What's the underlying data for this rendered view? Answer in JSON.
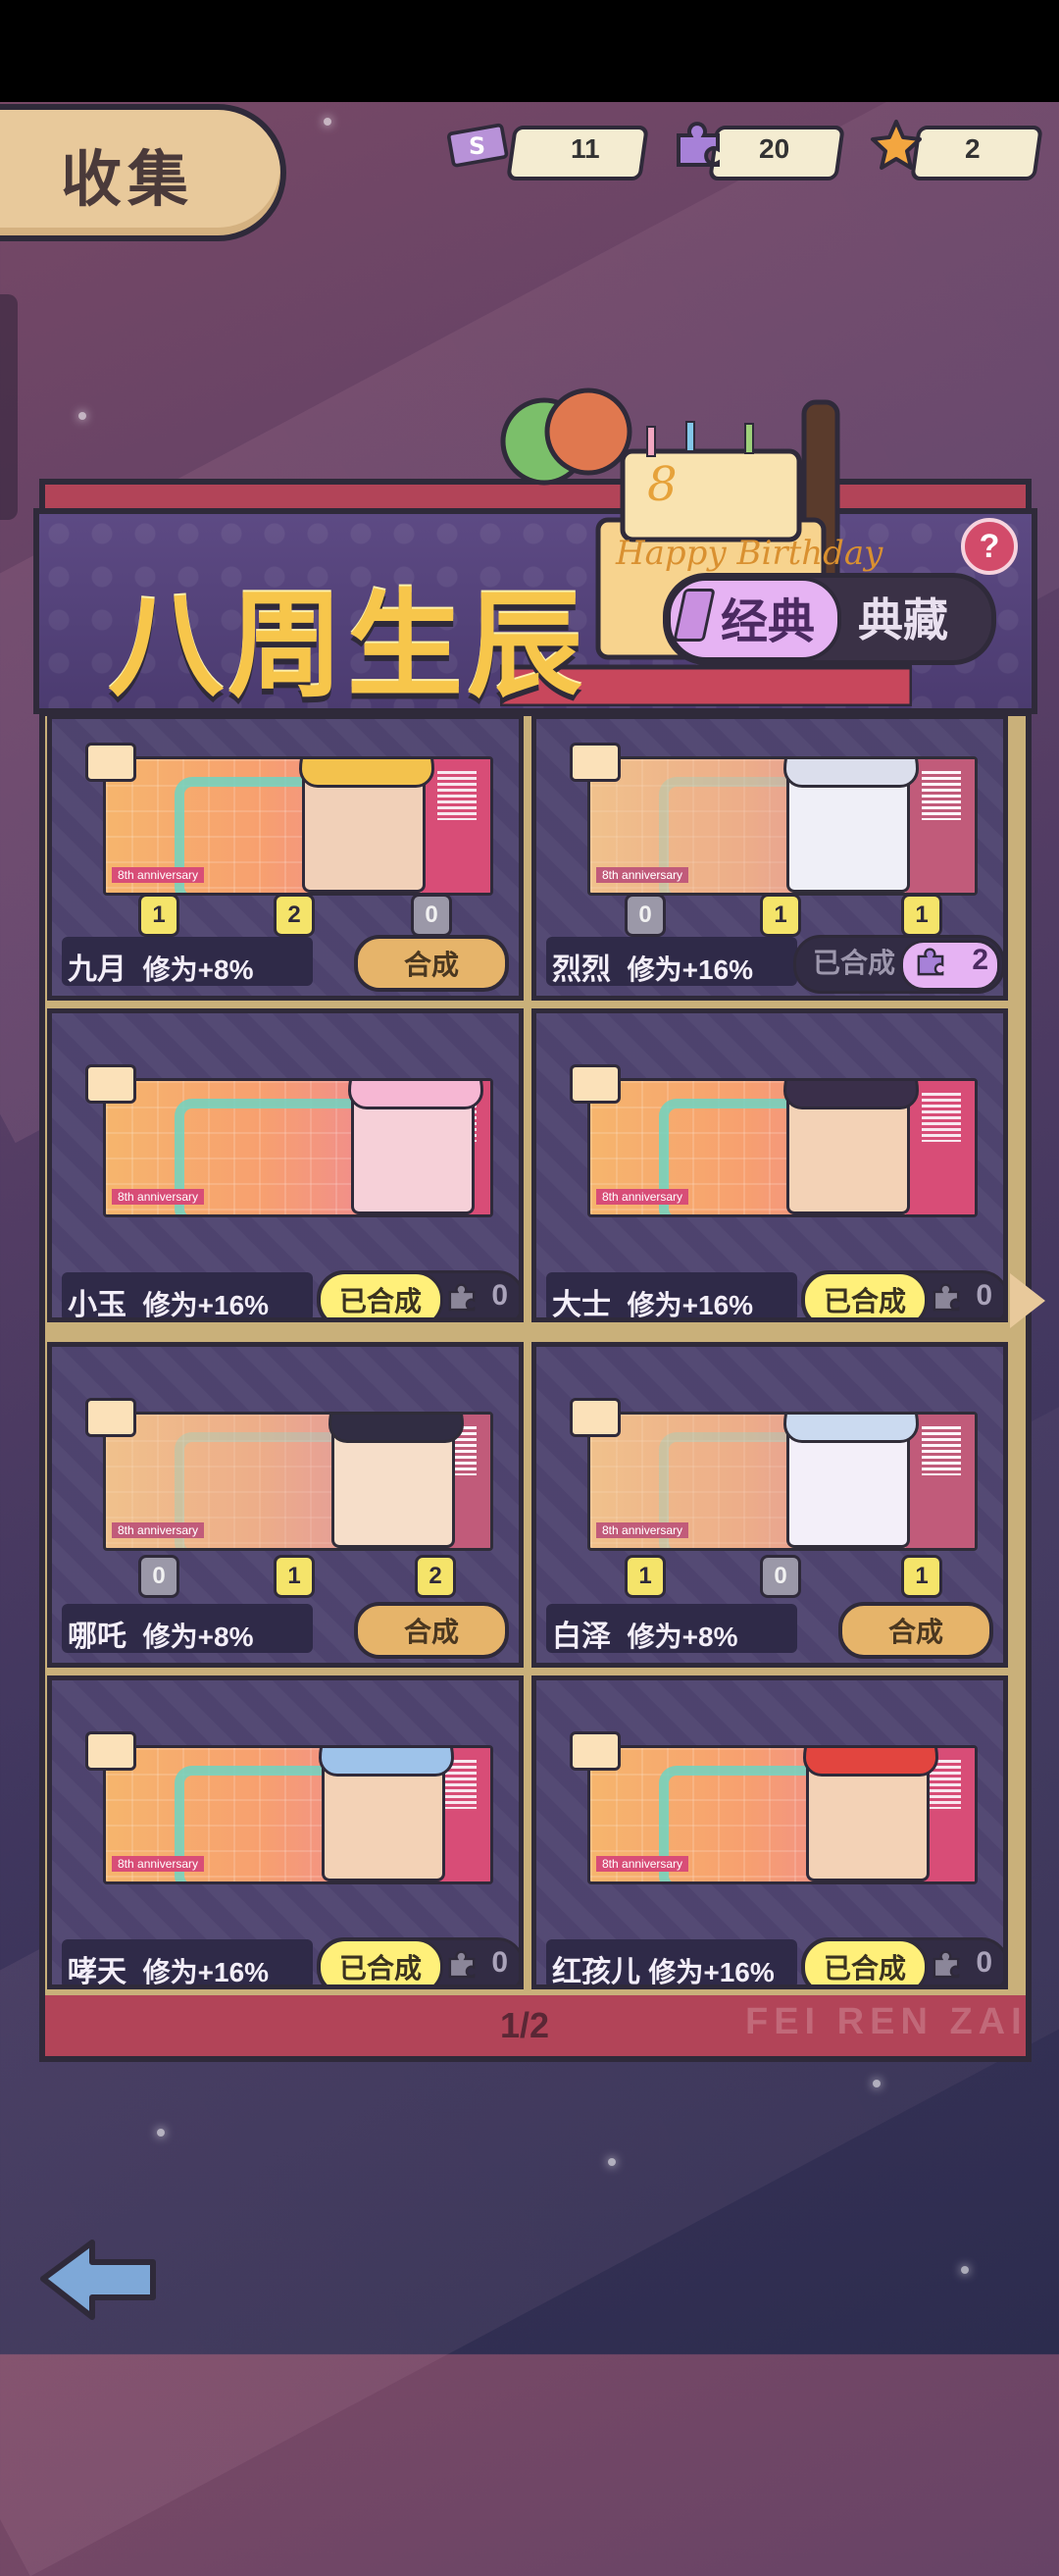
{
  "header": {
    "title": "收集",
    "currencies": [
      {
        "icon": "ticket-icon",
        "value": "11",
        "color": "#b892d8"
      },
      {
        "icon": "puzzle-icon",
        "value": "20",
        "color": "#a781d8"
      },
      {
        "icon": "star-icon",
        "value": "2",
        "color": "#f3a640"
      }
    ]
  },
  "banner": {
    "title": "八周生辰",
    "cake_text": "Happy Birthday",
    "tabs": [
      {
        "label": "经典",
        "active": true
      },
      {
        "label": "典藏",
        "active": false
      }
    ],
    "help": "?"
  },
  "cards": [
    {
      "name": "九月",
      "bonus": "修为+8%",
      "pieces": [
        "1",
        "2",
        "0"
      ],
      "action": "合成",
      "faded": false
    },
    {
      "name": "烈烈",
      "bonus": "修为+16%",
      "pieces": [
        "0",
        "1",
        "1"
      ],
      "action": "已合成",
      "count": "2",
      "count_style": "pink"
    },
    {
      "name": "小玉",
      "bonus": "修为+16%",
      "pieces": [],
      "action": "已合成",
      "count": "0"
    },
    {
      "name": "大士",
      "bonus": "修为+16%",
      "pieces": [],
      "action": "已合成",
      "count": "0"
    },
    {
      "name": "哪吒",
      "bonus": "修为+8%",
      "pieces": [
        "0",
        "1",
        "2"
      ],
      "action": "合成"
    },
    {
      "name": "白泽",
      "bonus": "修为+8%",
      "pieces": [
        "1",
        "0",
        "1"
      ],
      "action": "合成"
    },
    {
      "name": "哮天",
      "bonus": "修为+16%",
      "pieces": [],
      "action": "已合成",
      "count": "0"
    },
    {
      "name": "红孩儿",
      "bonus": "修为+16%",
      "pieces": [],
      "action": "已合成",
      "count": "0"
    }
  ],
  "ticket_label": "8th anniversary",
  "pagination": {
    "page": "1/2"
  },
  "watermark": "FEI REN ZAI"
}
